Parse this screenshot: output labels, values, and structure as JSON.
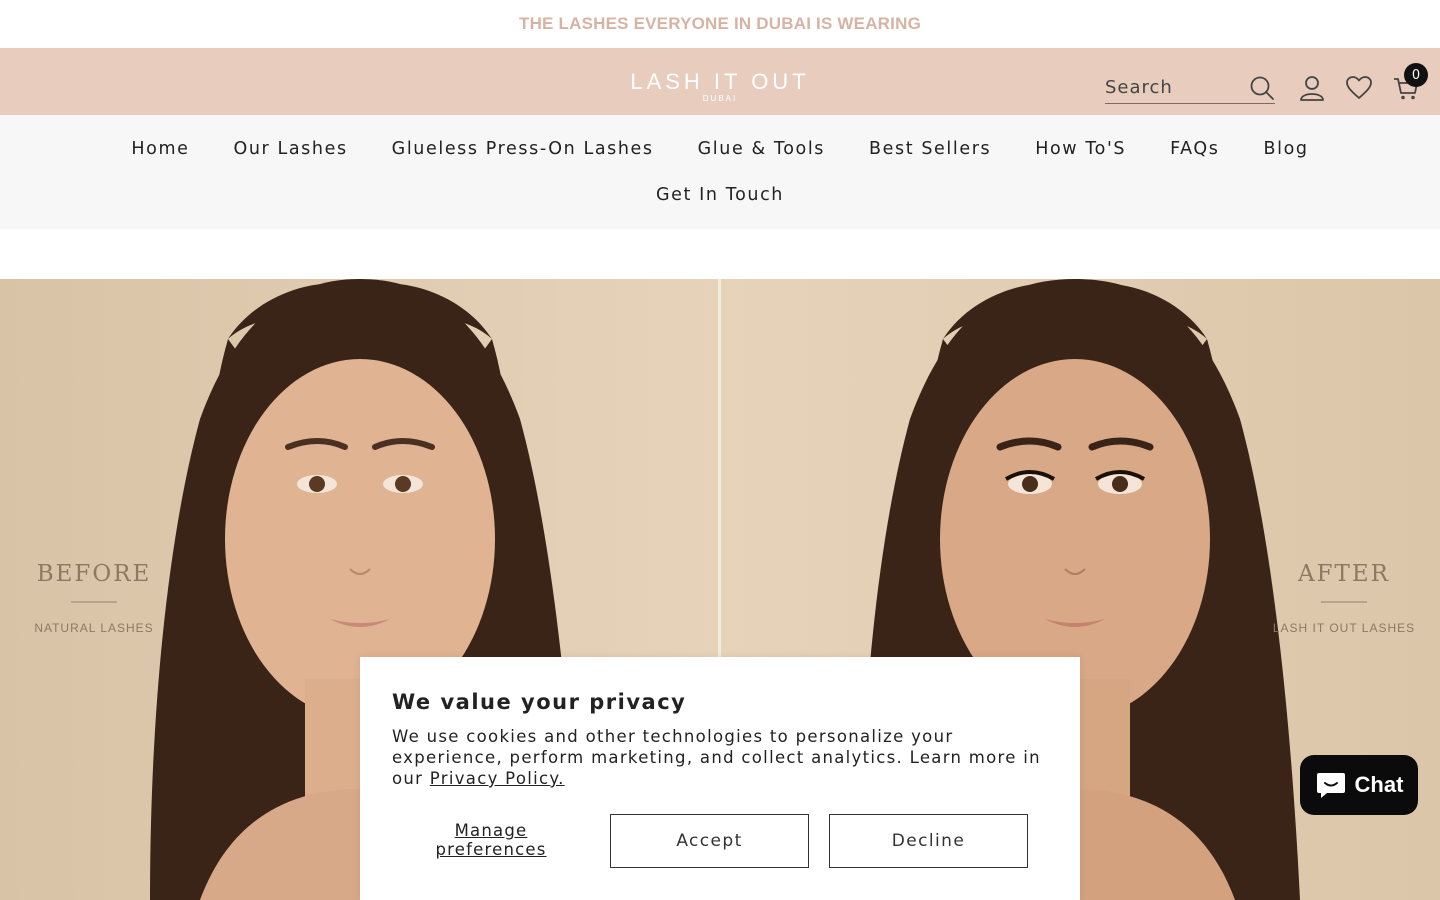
{
  "announcement": {
    "text": "THE LASHES EVERYONE IN DUBAI IS WEARING"
  },
  "header": {
    "logo_main": "LASH IT OUT",
    "logo_sub": "DUBAI",
    "search_placeholder": "Search",
    "cart_count": "0"
  },
  "nav": {
    "row1": [
      "Home",
      "Our Lashes",
      "Glueless Press-On Lashes",
      "Glue & Tools",
      "Best Sellers",
      "How To'S",
      "FAQs",
      "Blog"
    ],
    "row2": [
      "Get In Touch"
    ]
  },
  "hero": {
    "before_title": "BEFORE",
    "before_sub": "NATURAL LASHES",
    "after_title": "AFTER",
    "after_sub": "LASH IT OUT LASHES"
  },
  "consent": {
    "title": "We value your privacy",
    "body": "We use cookies and other technologies to personalize your experience, perform marketing, and collect analytics. Learn more in our",
    "policy_link": "Privacy Policy.",
    "manage_label": "Manage preferences",
    "accept_label": "Accept",
    "decline_label": "Decline"
  },
  "chat": {
    "label": "Chat"
  },
  "colors": {
    "header_bg": "#e8cdbf",
    "announcement_text": "#d6b3a2",
    "nav_bg": "#f7f7f7"
  }
}
